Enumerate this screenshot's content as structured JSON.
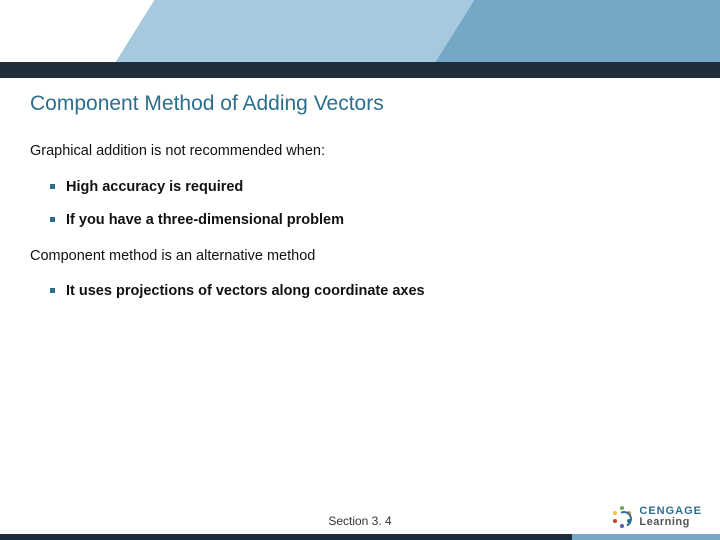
{
  "title": "Component Method of Adding Vectors",
  "body": {
    "p1": "Graphical addition is not recommended when:",
    "list1": [
      "High accuracy is required",
      "If you have a three-dimensional problem"
    ],
    "p2": "Component method is an alternative method",
    "list2": [
      "It uses projections of vectors along coordinate axes"
    ]
  },
  "footer": {
    "section": "Section 3. 4",
    "brand1": "CENGAGE",
    "brand2": "Learning"
  }
}
